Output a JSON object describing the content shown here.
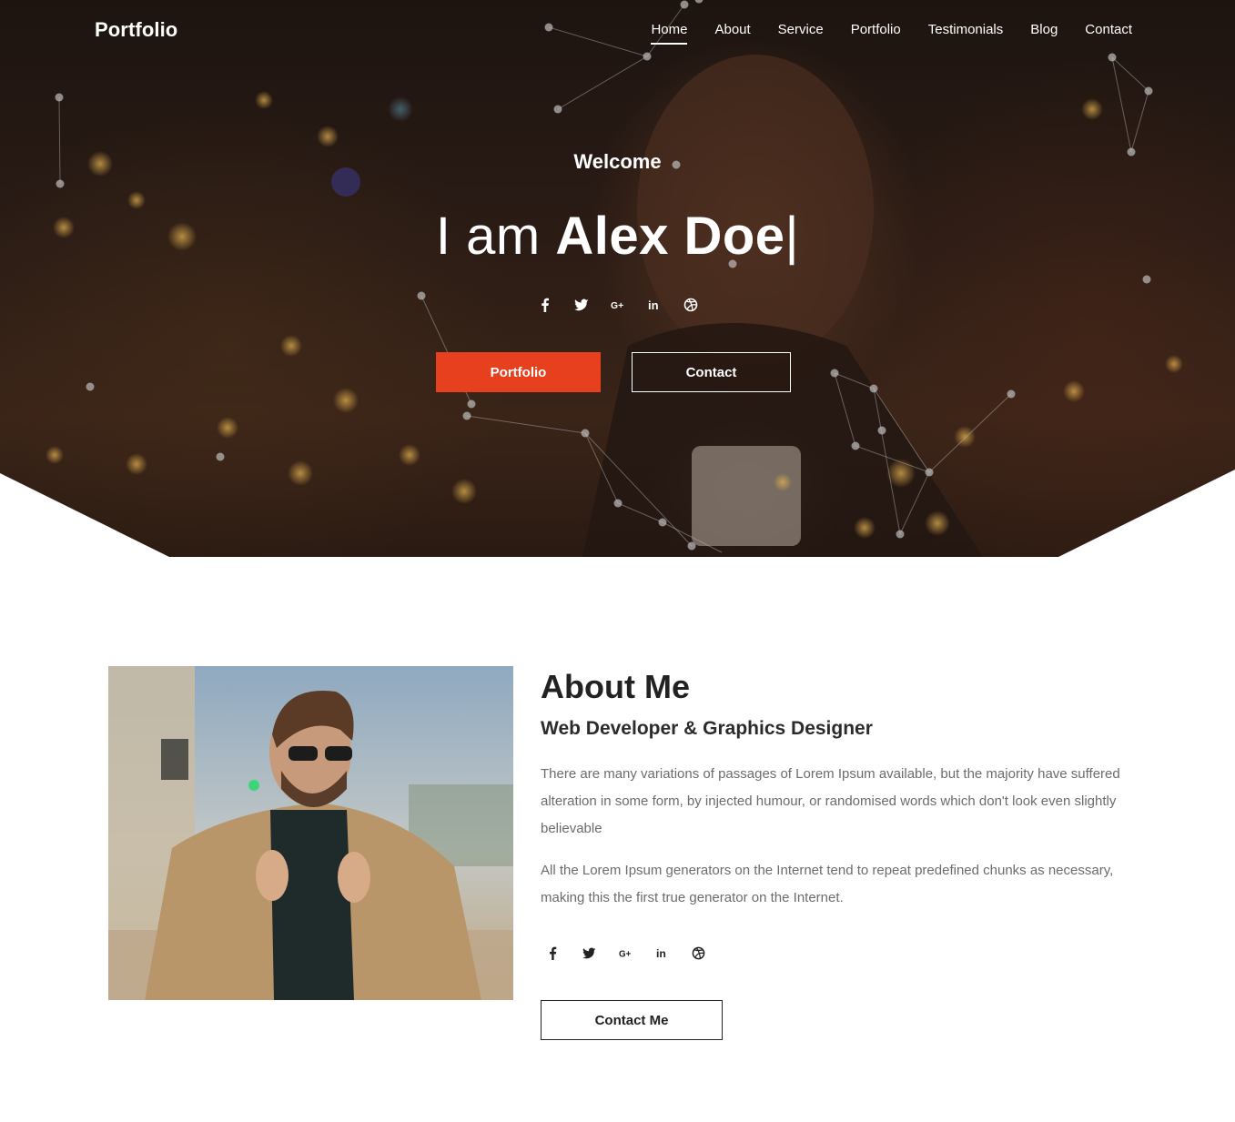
{
  "brand": {
    "logo_text": "Portfolio"
  },
  "nav": {
    "items": [
      {
        "label": "Home",
        "active": true
      },
      {
        "label": "About"
      },
      {
        "label": "Service"
      },
      {
        "label": "Portfolio"
      },
      {
        "label": "Testimonials"
      },
      {
        "label": "Blog"
      },
      {
        "label": "Contact"
      }
    ]
  },
  "hero": {
    "welcome": "Welcome",
    "headline_prefix": "I am ",
    "headline_name": "Alex Doe",
    "cursor": "|",
    "social_icons": [
      "facebook-icon",
      "twitter-icon",
      "google-plus-icon",
      "linkedin-icon",
      "dribbble-icon"
    ],
    "primary_button": "Portfolio",
    "secondary_button": "Contact"
  },
  "about": {
    "title": "About Me",
    "subtitle": "Web Developer & Graphics Designer",
    "paragraph_1": "There are many variations of passages of Lorem Ipsum available, but the majority have suffered alteration in some form, by injected humour, or randomised words which don't look even slightly believable",
    "paragraph_2": "All the Lorem Ipsum generators on the Internet tend to repeat predefined chunks as necessary, making this the first true generator on the Internet.",
    "social_icons": [
      "facebook-icon",
      "twitter-icon",
      "google-plus-icon",
      "linkedin-icon",
      "dribbble-icon"
    ],
    "contact_button": "Contact Me"
  },
  "colors": {
    "accent": "#e7401f",
    "text_dark": "#222222",
    "text_muted": "#6c6c6c"
  }
}
